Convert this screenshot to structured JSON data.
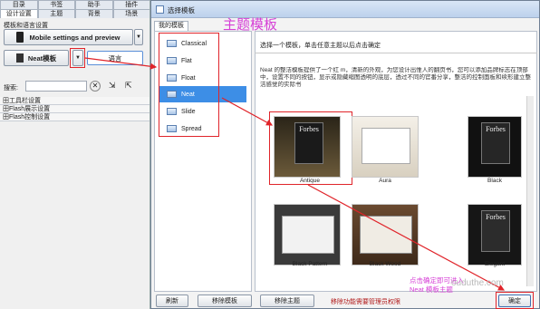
{
  "left": {
    "tabs_top": [
      "目录",
      "书签",
      "助手",
      "插件"
    ],
    "tabs_second": [
      "设计设置",
      "主题",
      "背景",
      "场景"
    ],
    "template_lang_label": "模板和语言设置",
    "mobile_settings_label": "Mobile settings and preview",
    "neat_label": "Neat模板",
    "language_label": "语言",
    "search_label": "搜索:",
    "search_value": "",
    "sections": [
      "田工具栏设置",
      "田Flash展示设置",
      "田Flash控制设置"
    ]
  },
  "dialog": {
    "title": "选择模板",
    "annotation_title": "主题模板",
    "tab_label": "我的模板",
    "instruction": "选择一个模板，单击任意主题以后点击确定",
    "description": "Neat 的整洁模板提供了一个红 m，清新的外观，为您设计出惟人的翻页书，您可以添加品牌标志在顶部中，设置不同的按钮，显示或隐藏缩图透明的底层，透过不同的官番分享，整洁的控制面板和续形建立整洁感觉的实际书",
    "templates": [
      "Classical",
      "Flat",
      "Float",
      "Neat",
      "Slide",
      "Spread"
    ],
    "selected_template": "Neat",
    "themes": [
      {
        "name": "Antique",
        "cover": "Forbes"
      },
      {
        "name": "Aura",
        "cover": ""
      },
      {
        "name": "Black",
        "cover": "Forbes"
      },
      {
        "name": "Black Pattern",
        "cover": ""
      },
      {
        "name": "Black Wood",
        "cover": ""
      },
      {
        "name": "Elegant",
        "cover": "Forbes"
      }
    ],
    "buttons": {
      "refresh": "刷新",
      "remove_template": "移除模板",
      "remove_theme": "移除主题",
      "ok": "确定"
    },
    "admin_note": "移除功能需要管理员权限",
    "ok_annotation": "点击确定即可进入\nNeat 模板主题",
    "watermark": "ouduthe.com"
  },
  "colors": {
    "accent_red": "#e0242a",
    "annotation_pink": "#d63fd6",
    "selection_blue": "#3d8ee6"
  }
}
